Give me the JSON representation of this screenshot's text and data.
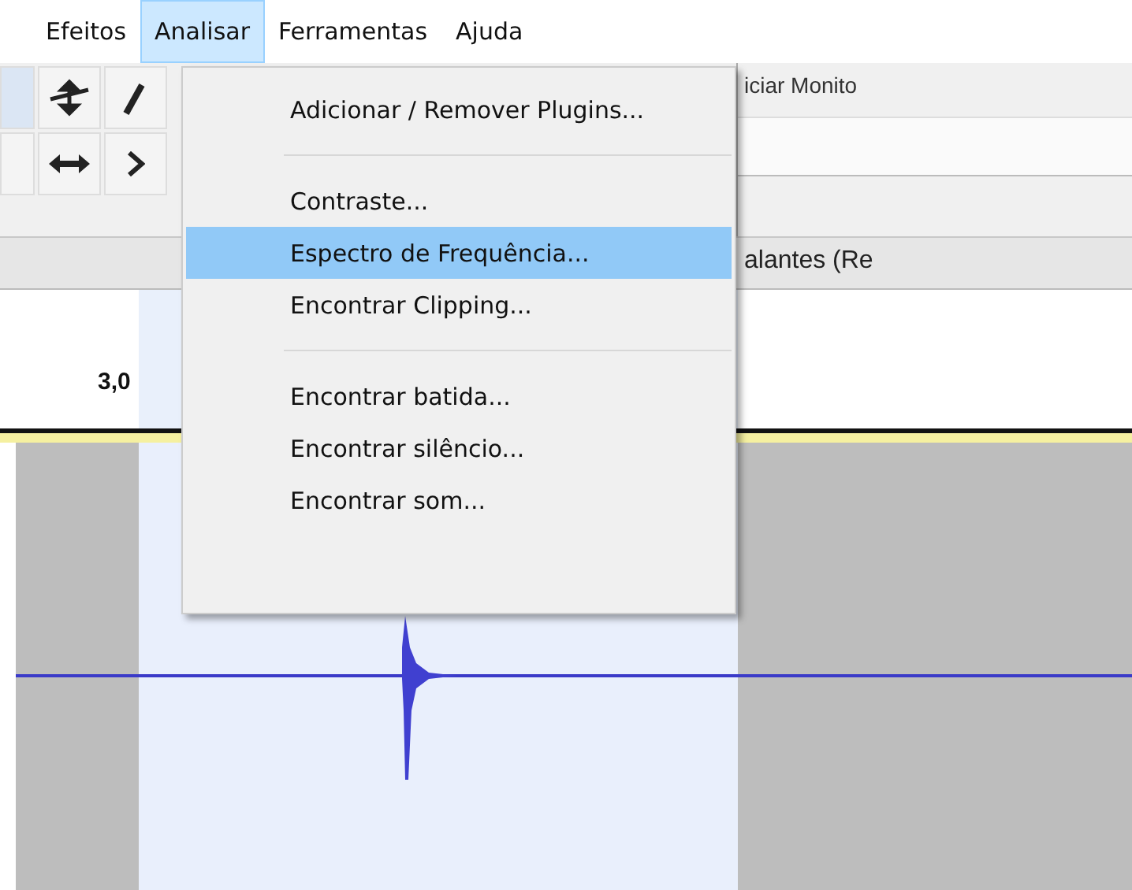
{
  "menu_bar": [
    {
      "label": "Efeitos",
      "selected": false
    },
    {
      "label": "Analisar",
      "selected": true
    },
    {
      "label": "Ferramentas",
      "selected": false
    },
    {
      "label": "Ajuda",
      "selected": false
    }
  ],
  "dropdown": {
    "items": [
      {
        "kind": "item",
        "label": "Adicionar / Remover Plugins...",
        "selected": false
      },
      {
        "kind": "separator"
      },
      {
        "kind": "item",
        "label": "Contraste...",
        "selected": false
      },
      {
        "kind": "item",
        "label": "Espectro de Frequência...",
        "selected": true
      },
      {
        "kind": "item",
        "label": "Encontrar Clipping...",
        "selected": false
      },
      {
        "kind": "separator"
      },
      {
        "kind": "item",
        "label": "Encontrar batida...",
        "selected": false
      },
      {
        "kind": "item",
        "label": "Encontrar silêncio...",
        "selected": false
      },
      {
        "kind": "item",
        "label": "Encontrar som...",
        "selected": false
      }
    ]
  },
  "meter_toolbar": {
    "label": "iciar Monito"
  },
  "device_toolbar": {
    "label": "alantes (Re"
  },
  "timeline": {
    "tick_label": "3,0"
  }
}
